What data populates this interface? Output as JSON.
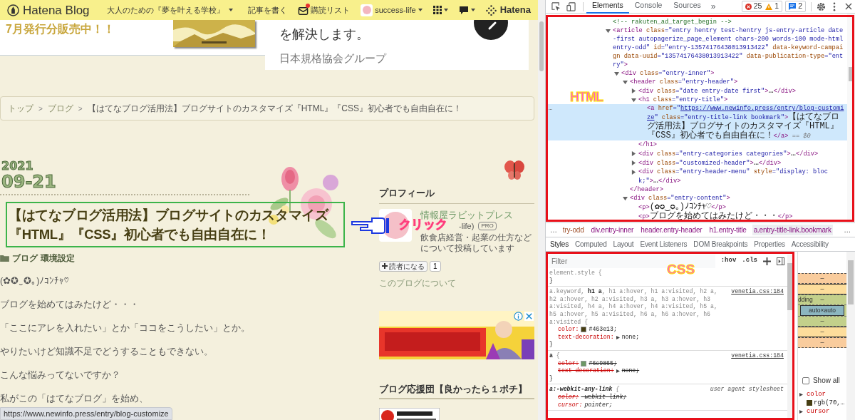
{
  "page": {
    "topbar": {
      "logo": "Hatena Blog",
      "blog_title": "大人のための『夢を叶える学校』",
      "links": [
        {
          "kind": "write",
          "label": "記事を書く"
        },
        {
          "kind": "subscribe",
          "label": "購読リスト",
          "notified": true
        },
        {
          "kind": "account",
          "label": "success-life"
        },
        {
          "kind": "apps"
        },
        {
          "kind": "comments"
        },
        {
          "kind": "brand",
          "label": "Hatena"
        }
      ]
    },
    "ad_strip": {
      "headline": "7月発行分販売中！！",
      "lead": "を解決します。",
      "sponsor": "日本規格協会グループ"
    },
    "breadcrumb": {
      "separator": ">",
      "items": [
        "トップ",
        "ブログ",
        "【はてなブログ活用法】ブログサイトのカスタマイズ『HTML』『CSS』初心者でも自由自在に！"
      ]
    },
    "entry": {
      "year": "2021",
      "date": "09-21",
      "title": "【はてなブログ活用法】ブログサイトのカスタマイズ『HTML』『CSS』初心者でも自由自在に！",
      "categories": [
        "ブログ",
        "環境設定"
      ],
      "paragraphs": [
        "(✿✪‿✪｡)ﾉｺﾝﾁｬ♡",
        "ブログを始めてはみたけど・・・",
        "「ここにアレを入れたい」とか「ココをこうしたい」とか。",
        "やりたいけど知識不足でどうすることもできない。",
        "こんな悩みってないですか？",
        "私がこの「はてなブログ」を始め、"
      ]
    },
    "sidebar": {
      "profile_heading": "プロフィール",
      "name": "情報屋ラビットプレス",
      "id_fragment": "-life)",
      "badge": "PRO",
      "description": "飲食店経営・起業の仕方などについて投稿しています",
      "follow_button": "読者になる",
      "follower_count": "1",
      "about_link": "このブログについて",
      "support_heading": "ブログ応援団【良かったら１ポチ】"
    },
    "annotation": {
      "label": "クリック"
    },
    "status_url": "https://www.newinfo.press/entry/blog-customize"
  },
  "devtools": {
    "tabs": [
      {
        "label": "Elements",
        "selected": true
      },
      {
        "label": "Console",
        "selected": false
      },
      {
        "label": "Sources",
        "selected": false
      }
    ],
    "more_tabs": "»",
    "errors": "25",
    "warnings": "1",
    "messages": "2",
    "elements": {
      "annotation": "HTML",
      "gutter_mark": "…",
      "tree": [
        {
          "kind": "leaf",
          "selected": false,
          "tokens": [
            {
              "kind": "comment",
              "text": "<!-- rakuten_ad_target_begin -->"
            }
          ]
        },
        {
          "kind": "node",
          "selected": false,
          "expanded": true,
          "tokens": [
            {
              "kind": "tag",
              "text": "<article"
            },
            {
              "kind": "attr",
              "text": " class"
            },
            {
              "kind": "val",
              "text": "=\"entry hentry test-hentry js-entry-article date-first autopagerize_page_element chars-200 words-100 mode-html entry-odd\""
            },
            {
              "kind": "attr",
              "text": " id"
            },
            {
              "kind": "val",
              "text": "=\"entry-13574176438013913422\""
            },
            {
              "kind": "attr",
              "text": " data-keyword-campaign"
            },
            {
              "kind": "attr",
              "text": " data-uuid"
            },
            {
              "kind": "val",
              "text": "=\"13574176438013913422\""
            },
            {
              "kind": "attr",
              "text": " data-publication-type"
            },
            {
              "kind": "val",
              "text": "=\"entry\""
            },
            {
              "kind": "tag",
              "text": ">"
            }
          ],
          "children": [
            {
              "kind": "node",
              "selected": false,
              "expanded": true,
              "tokens": [
                {
                  "kind": "tag",
                  "text": "<div"
                },
                {
                  "kind": "attr",
                  "text": " class"
                },
                {
                  "kind": "val",
                  "text": "=\"entry-inner\""
                },
                {
                  "kind": "tag",
                  "text": ">"
                }
              ],
              "children": [
                {
                  "kind": "node",
                  "selected": false,
                  "expanded": true,
                  "tokens": [
                    {
                      "kind": "tag",
                      "text": "<header"
                    },
                    {
                      "kind": "attr",
                      "text": " class"
                    },
                    {
                      "kind": "val",
                      "text": "=\"entry-header\""
                    },
                    {
                      "kind": "tag",
                      "text": ">"
                    }
                  ],
                  "children": [
                    {
                      "kind": "node",
                      "selected": false,
                      "expanded": false,
                      "tokens": [
                        {
                          "kind": "tag",
                          "text": "<div"
                        },
                        {
                          "kind": "attr",
                          "text": " class"
                        },
                        {
                          "kind": "val",
                          "text": "=\"date entry-date first\""
                        },
                        {
                          "kind": "tag",
                          "text": ">"
                        },
                        {
                          "kind": "text",
                          "text": "…"
                        },
                        {
                          "kind": "tag",
                          "text": "</div>"
                        }
                      ]
                    },
                    {
                      "kind": "node",
                      "selected": false,
                      "expanded": true,
                      "tokens": [
                        {
                          "kind": "tag",
                          "text": "<h1"
                        },
                        {
                          "kind": "attr",
                          "text": " class"
                        },
                        {
                          "kind": "val",
                          "text": "=\"entry-title\""
                        },
                        {
                          "kind": "tag",
                          "text": ">"
                        }
                      ],
                      "children": [
                        {
                          "kind": "leaf",
                          "selected": true,
                          "tokens": [
                            {
                              "kind": "tag",
                              "text": "<a"
                            },
                            {
                              "kind": "attr",
                              "text": " href"
                            },
                            {
                              "kind": "val",
                              "text": "=\""
                            },
                            {
                              "kind": "link",
                              "text": "https://www.newinfo.press/entry/blog-customize"
                            },
                            {
                              "kind": "val",
                              "text": "\""
                            },
                            {
                              "kind": "attr",
                              "text": " class"
                            },
                            {
                              "kind": "val",
                              "text": "=\"entry-title-link bookmark\""
                            },
                            {
                              "kind": "tag",
                              "text": ">"
                            },
                            {
                              "kind": "text",
                              "text": "【はてなブログ活用法】ブログサイトのカスタマイズ『HTML』『CSS』初心者でも自由自在に！"
                            },
                            {
                              "kind": "tag",
                              "text": "</a>"
                            },
                            {
                              "kind": "dim",
                              "text": " == $0"
                            }
                          ]
                        }
                      ],
                      "end": [
                        {
                          "kind": "tag",
                          "text": "</h1>"
                        }
                      ]
                    },
                    {
                      "kind": "node",
                      "selected": false,
                      "expanded": false,
                      "tokens": [
                        {
                          "kind": "tag",
                          "text": "<div"
                        },
                        {
                          "kind": "attr",
                          "text": " class"
                        },
                        {
                          "kind": "val",
                          "text": "=\"entry-categories categories\""
                        },
                        {
                          "kind": "tag",
                          "text": ">"
                        },
                        {
                          "kind": "text",
                          "text": "…"
                        },
                        {
                          "kind": "tag",
                          "text": "</div>"
                        }
                      ]
                    },
                    {
                      "kind": "node",
                      "selected": false,
                      "expanded": false,
                      "tokens": [
                        {
                          "kind": "tag",
                          "text": "<div"
                        },
                        {
                          "kind": "attr",
                          "text": " class"
                        },
                        {
                          "kind": "val",
                          "text": "=\"customized-header\""
                        },
                        {
                          "kind": "tag",
                          "text": ">"
                        },
                        {
                          "kind": "text",
                          "text": "…"
                        },
                        {
                          "kind": "tag",
                          "text": "</div>"
                        }
                      ]
                    },
                    {
                      "kind": "node",
                      "selected": false,
                      "expanded": false,
                      "tokens": [
                        {
                          "kind": "tag",
                          "text": "<div"
                        },
                        {
                          "kind": "attr",
                          "text": " class"
                        },
                        {
                          "kind": "val",
                          "text": "=\"entry-header-menu\""
                        },
                        {
                          "kind": "attr",
                          "text": " style"
                        },
                        {
                          "kind": "val",
                          "text": "=\"display: block;\""
                        },
                        {
                          "kind": "tag",
                          "text": ">"
                        },
                        {
                          "kind": "text",
                          "text": "…"
                        },
                        {
                          "kind": "tag",
                          "text": "</div>"
                        }
                      ]
                    }
                  ],
                  "end": [
                    {
                      "kind": "tag",
                      "text": "</header>"
                    }
                  ]
                },
                {
                  "kind": "node",
                  "selected": false,
                  "expanded": true,
                  "tokens": [
                    {
                      "kind": "tag",
                      "text": "<div"
                    },
                    {
                      "kind": "attr",
                      "text": " class"
                    },
                    {
                      "kind": "val",
                      "text": "=\"entry-content\""
                    },
                    {
                      "kind": "tag",
                      "text": ">"
                    }
                  ],
                  "children": [
                    {
                      "kind": "leaf",
                      "selected": false,
                      "tokens": [
                        {
                          "kind": "tag",
                          "text": "<p>"
                        },
                        {
                          "kind": "text",
                          "text": "(✿✪‿✪｡)ﾉｺﾝﾁｬ♡"
                        },
                        {
                          "kind": "tag",
                          "text": "</p>"
                        }
                      ]
                    },
                    {
                      "kind": "leaf",
                      "selected": false,
                      "tokens": [
                        {
                          "kind": "tag",
                          "text": "<p>"
                        },
                        {
                          "kind": "text",
                          "text": "ブログを始めてはみたけど・・・"
                        },
                        {
                          "kind": "tag",
                          "text": "</p>"
                        }
                      ]
                    }
                  ]
                }
              ]
            }
          ]
        }
      ]
    },
    "crumbs": {
      "leading": "…",
      "trailing": "…",
      "items": [
        {
          "label": "try-odd",
          "kind": "class",
          "selected": false
        },
        {
          "label": "div.entry-inner",
          "kind": "element",
          "selected": false
        },
        {
          "label": "header.entry-header",
          "kind": "element",
          "selected": false
        },
        {
          "label": "h1.entry-title",
          "kind": "element",
          "selected": false
        },
        {
          "label": "a.entry-title-link.bookmark",
          "kind": "element",
          "selected": true
        }
      ]
    },
    "subtabs": [
      {
        "label": "Styles",
        "selected": true
      },
      {
        "label": "Computed",
        "selected": false
      },
      {
        "label": "Layout",
        "selected": false
      },
      {
        "label": "Event Listeners",
        "selected": false
      },
      {
        "label": "DOM Breakpoints",
        "selected": false
      },
      {
        "label": "Properties",
        "selected": false
      },
      {
        "label": "Accessibility",
        "selected": false
      }
    ],
    "styles": {
      "annotation": "CSS",
      "filter_placeholder": "Filter",
      "toggles": [
        ":hov",
        ".cls"
      ],
      "rules": [
        {
          "kind": "inline",
          "selector": [
            {
              "s": "element.style {",
              "matched": false
            }
          ],
          "close": "}"
        },
        {
          "kind": "author",
          "source": "venetia.css:184",
          "selector": [
            {
              "s": "a.keyword, ",
              "matched": false
            },
            {
              "s": "h1 a",
              "matched": true
            },
            {
              "s": ", h1 a:hover, h1 a:visited, h2 a, h2 a:hover, h2 a:visited, h3 a, h3 a:hover, h3 a:visited, h4 a, h4 a:hover, h4 a:visited, h5 a, h5 a:hover, h5 a:visited, h6 a, h6 a:hover, h6 a:visited {",
              "matched": false
            }
          ],
          "props": [
            {
              "name": "color:",
              "value": "#463e13;",
              "color": "#463e13",
              "struck": false
            },
            {
              "name": "text-decoration:",
              "value": "none;",
              "expandable": true,
              "struck": false
            }
          ],
          "close": "}"
        },
        {
          "kind": "author",
          "source": "venetia.css:184",
          "selector": [
            {
              "s": "a",
              "matched": true
            },
            {
              "s": " {",
              "matched": false
            }
          ],
          "props": [
            {
              "name": "color:",
              "value": "#6c9865;",
              "color": "#6c9865",
              "struck": true
            },
            {
              "name": "text-decoration:",
              "value": "none;",
              "expandable": true,
              "struck": true
            }
          ],
          "close": "}"
        },
        {
          "kind": "ua",
          "source": "user agent stylesheet",
          "selector": [
            {
              "s": "a:-webkit-any-link",
              "matched": true
            },
            {
              "s": " {",
              "matched": false
            }
          ],
          "props": [
            {
              "name": "color:",
              "value": "-webkit-link;",
              "struck": true
            },
            {
              "name": "cursor:",
              "value": "pointer;",
              "struck": false
            }
          ]
        }
      ]
    },
    "box_model": [
      {
        "kind": "margin",
        "text": "–"
      },
      {
        "kind": "border",
        "text": "–"
      },
      {
        "kind": "padding",
        "text": "–",
        "label": "dding"
      },
      {
        "kind": "content",
        "text": "auto×auto"
      },
      {
        "kind": "padding",
        "text": "–"
      },
      {
        "kind": "border",
        "text": "–"
      },
      {
        "kind": "margin",
        "text": "–"
      }
    ],
    "computed": {
      "show_all": {
        "label": "Show all",
        "checked": false
      },
      "properties": [
        {
          "name": "color",
          "value": "rgb(70,…",
          "color": "#463e13"
        },
        {
          "name": "cursor"
        }
      ]
    }
  }
}
